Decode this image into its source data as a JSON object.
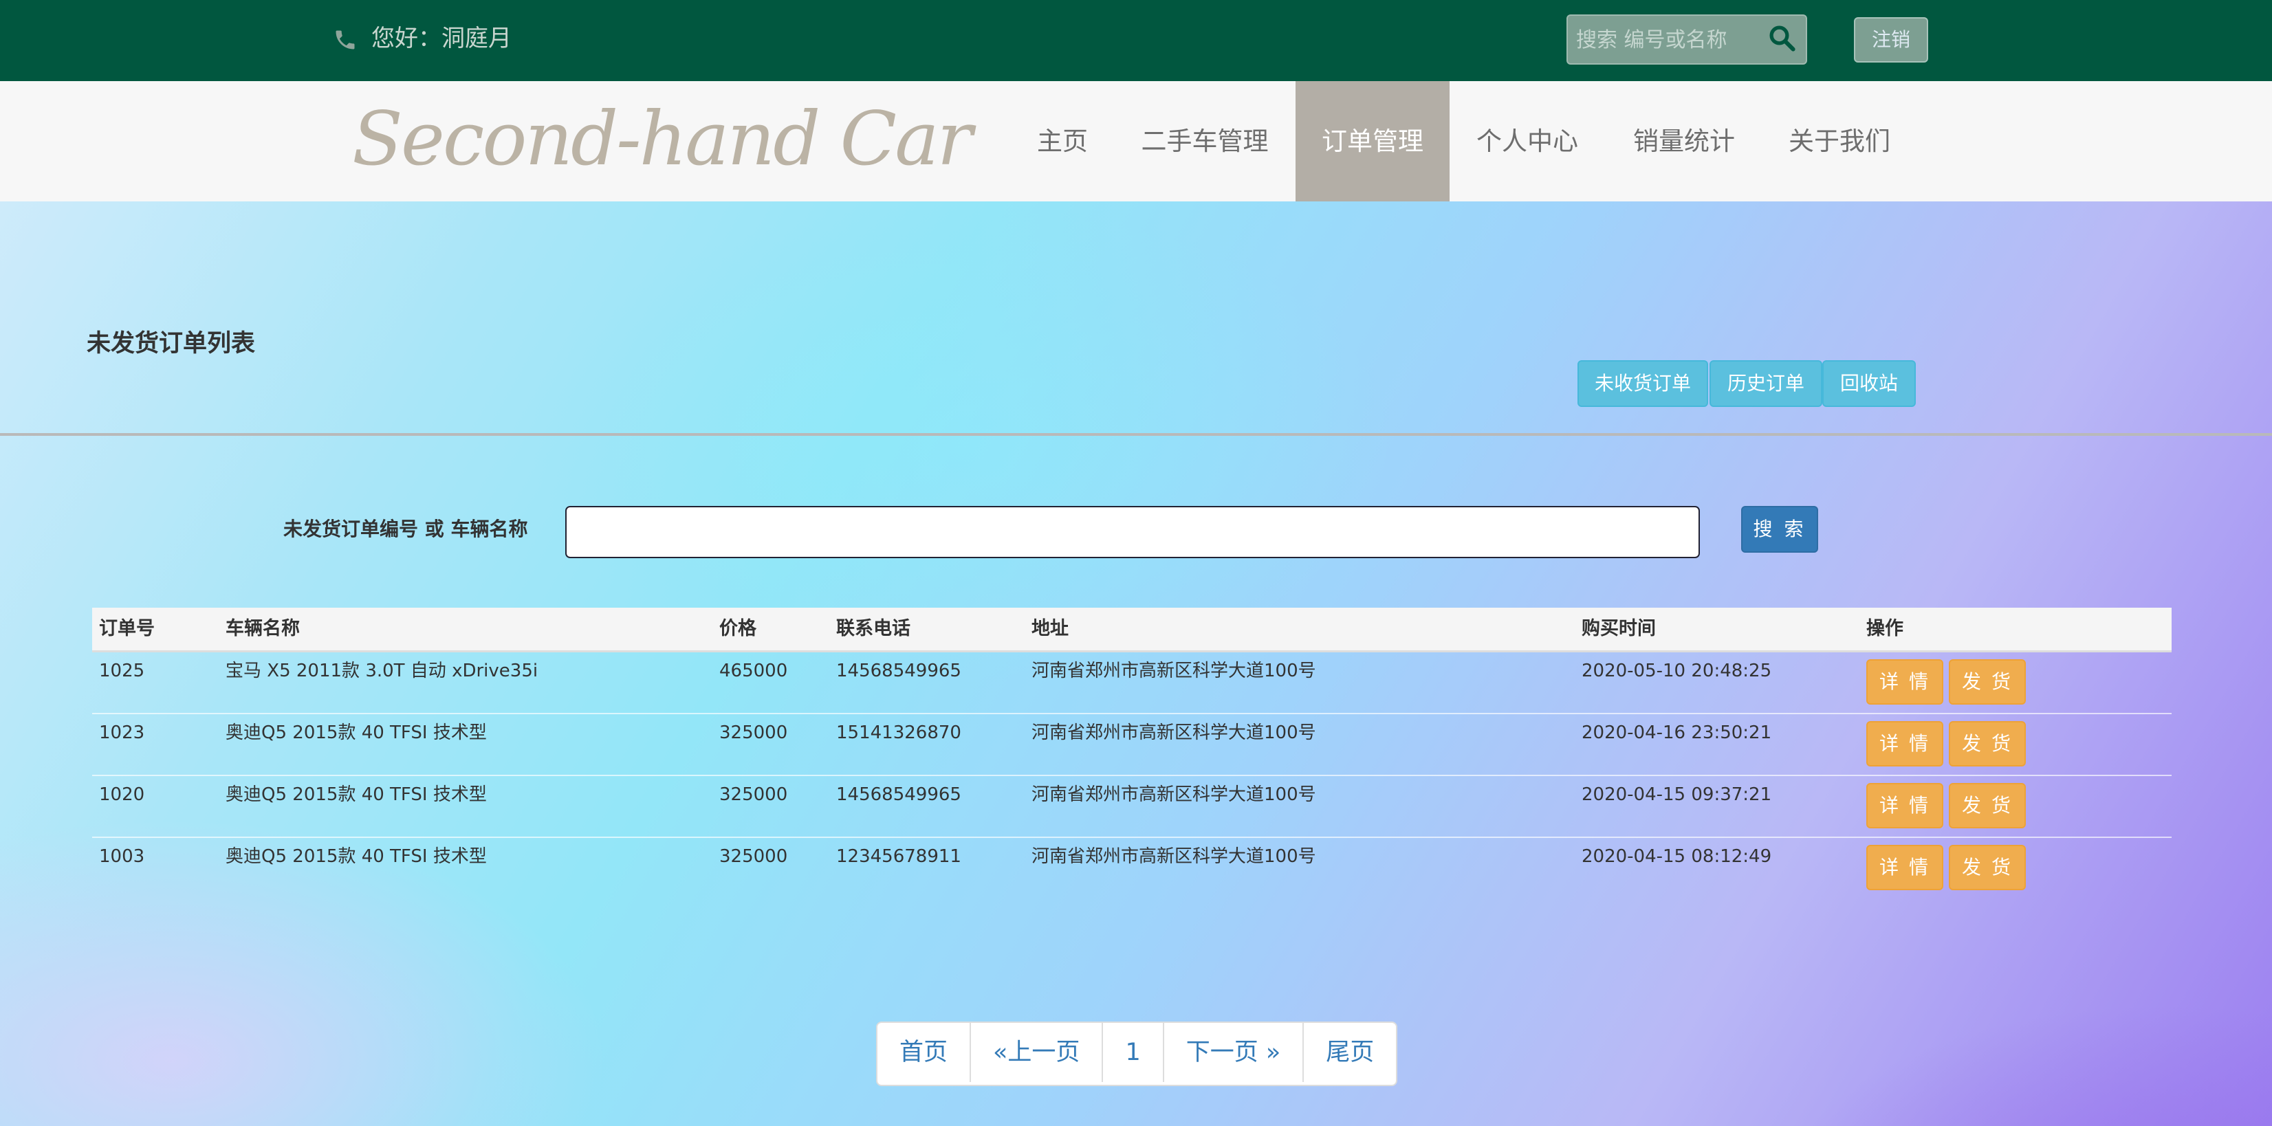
{
  "header": {
    "greeting": "您好：洞庭月",
    "search_placeholder": "搜索 编号或名称",
    "logout_label": "注销"
  },
  "brand": {
    "logo_text": "Second-hand Car"
  },
  "nav": {
    "items": [
      {
        "label": "主页"
      },
      {
        "label": "二手车管理"
      },
      {
        "label": "订单管理",
        "active": true
      },
      {
        "label": "个人中心"
      },
      {
        "label": "销量统计"
      },
      {
        "label": "关于我们"
      }
    ]
  },
  "main": {
    "title": "未发货订单列表",
    "tabs": [
      {
        "label": "未收货订单"
      },
      {
        "label": "历史订单"
      },
      {
        "label": "回收站"
      }
    ],
    "search": {
      "label": "未发货订单编号 或 车辆名称",
      "value": "",
      "button_label": "搜 索"
    },
    "table": {
      "headers": [
        "订单号",
        "车辆名称",
        "价格",
        "联系电话",
        "地址",
        "购买时间",
        "操作"
      ],
      "rows": [
        {
          "id": "1025",
          "car": "宝马 X5 2011款 3.0T 自动 xDrive35i",
          "price": "465000",
          "phone": "14568549965",
          "address": "河南省郑州市高新区科学大道100号",
          "time": "2020-05-10 20:48:25"
        },
        {
          "id": "1023",
          "car": "奥迪Q5 2015款 40 TFSI 技术型",
          "price": "325000",
          "phone": "15141326870",
          "address": "河南省郑州市高新区科学大道100号",
          "time": "2020-04-16 23:50:21"
        },
        {
          "id": "1020",
          "car": "奥迪Q5 2015款 40 TFSI 技术型",
          "price": "325000",
          "phone": "14568549965",
          "address": "河南省郑州市高新区科学大道100号",
          "time": "2020-04-15 09:37:21"
        },
        {
          "id": "1003",
          "car": "奥迪Q5 2015款 40 TFSI 技术型",
          "price": "325000",
          "phone": "12345678911",
          "address": "河南省郑州市高新区科学大道100号",
          "time": "2020-04-15 08:12:49"
        }
      ],
      "actions": {
        "detail": "详 情",
        "ship": "发 货"
      }
    },
    "pagination": {
      "first": "首页",
      "prev": "«上一页",
      "current": "1",
      "next": "下一页 »",
      "last": "尾页"
    }
  },
  "colors": {
    "topbar": "#01573f",
    "active_nav": "#b3aea6",
    "info_button": "#5bc0de",
    "primary_button": "#337ab7",
    "warning_button": "#f0ad4e"
  }
}
